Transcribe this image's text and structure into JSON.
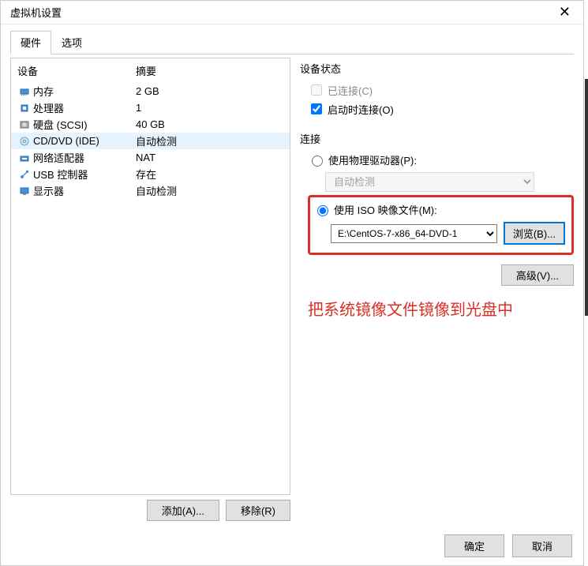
{
  "window": {
    "title": "虚拟机设置"
  },
  "tabs": {
    "hardware": "硬件",
    "options": "选项"
  },
  "columns": {
    "device": "设备",
    "summary": "摘要"
  },
  "devices": [
    {
      "id": "memory",
      "name": "内存",
      "summary": "2 GB"
    },
    {
      "id": "cpu",
      "name": "处理器",
      "summary": "1"
    },
    {
      "id": "disk",
      "name": "硬盘 (SCSI)",
      "summary": "40 GB"
    },
    {
      "id": "cddvd",
      "name": "CD/DVD (IDE)",
      "summary": "自动检测"
    },
    {
      "id": "net",
      "name": "网络适配器",
      "summary": "NAT"
    },
    {
      "id": "usb",
      "name": "USB 控制器",
      "summary": "存在"
    },
    {
      "id": "display",
      "name": "显示器",
      "summary": "自动检测"
    }
  ],
  "buttons": {
    "add": "添加(A)...",
    "remove": "移除(R)",
    "browse": "浏览(B)...",
    "advanced": "高级(V)...",
    "ok": "确定",
    "cancel": "取消"
  },
  "status": {
    "section": "设备状态",
    "connected": "已连接(C)",
    "connect_at_power": "启动时连接(O)"
  },
  "connection": {
    "section": "连接",
    "physical": "使用物理驱动器(P):",
    "physical_value": "自动检测",
    "iso": "使用 ISO 映像文件(M):",
    "iso_value": "E:\\CentOS-7-x86_64-DVD-1"
  },
  "annotation": "把系统镜像文件镜像到光盘中"
}
